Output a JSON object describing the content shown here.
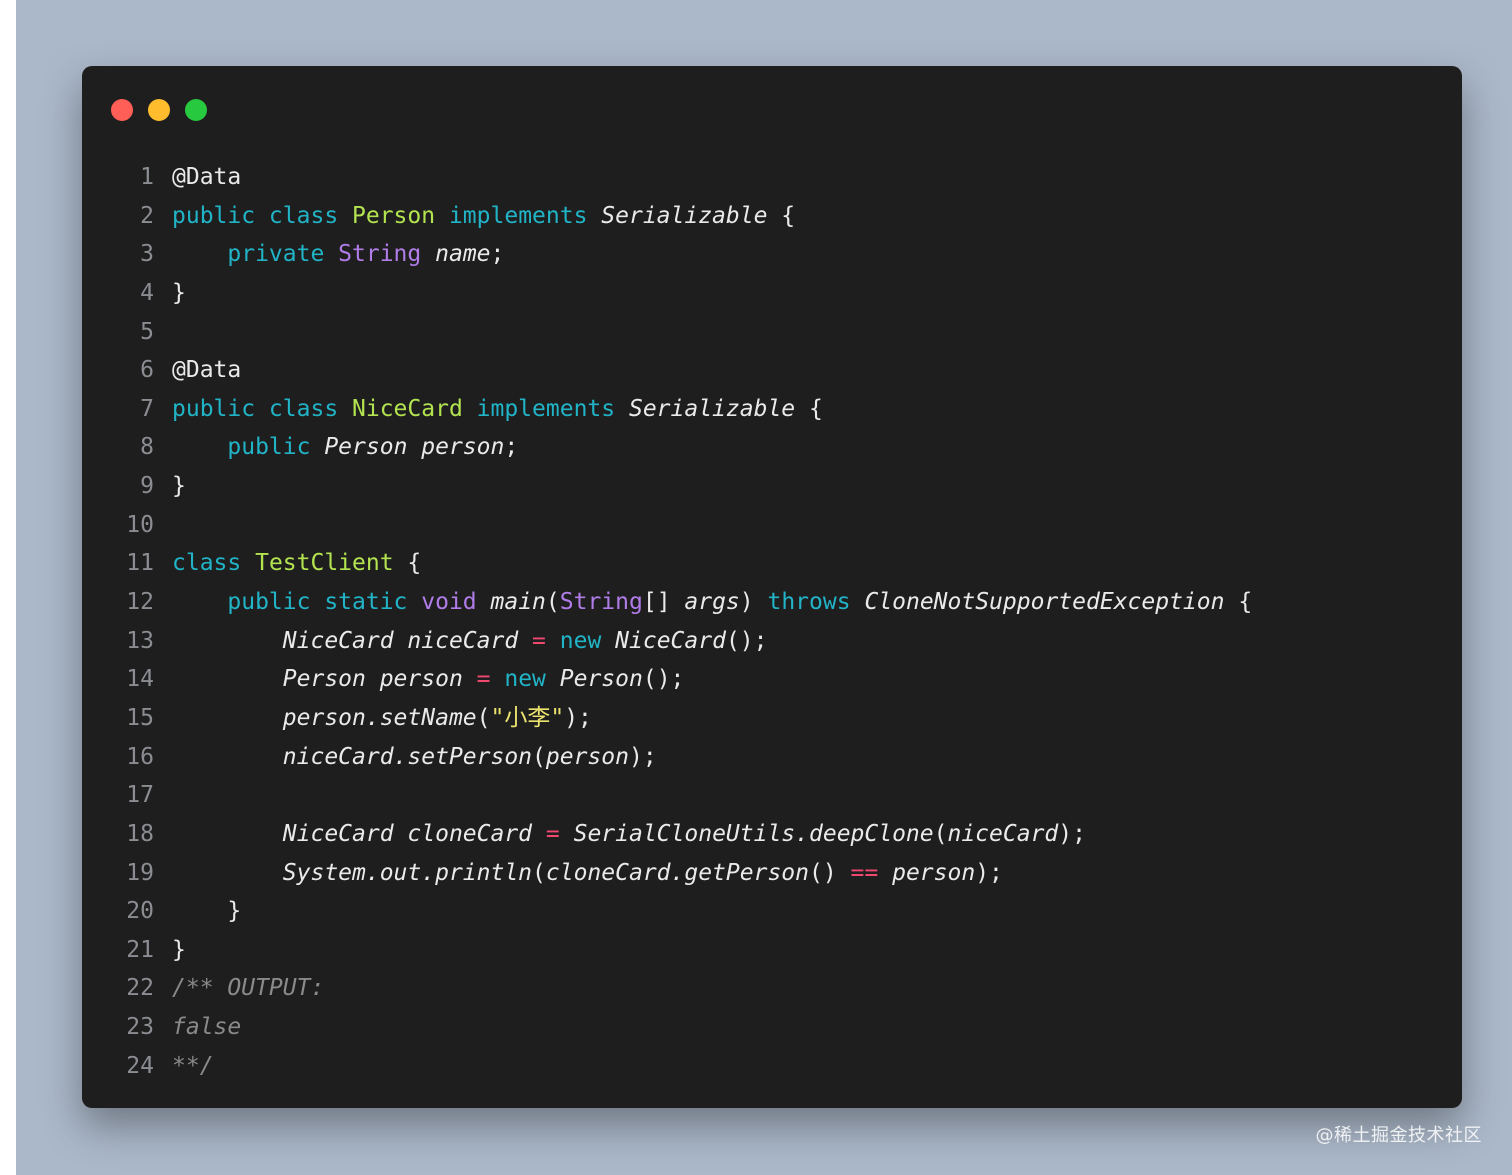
{
  "colors": {
    "background": "#abb8c9",
    "window": "#1e1e1f",
    "dot_close": "#ff5f56",
    "dot_minimize": "#ffbd2e",
    "dot_maximize": "#27c93f",
    "keyword": "#21b3c6",
    "type": "#b07ce8",
    "class_name": "#b3e34f",
    "string": "#ece36f",
    "operator": "#f0486f",
    "comment": "#8a8a8a",
    "plain": "#eaeaea"
  },
  "window": {
    "dots": [
      "close-dot",
      "minimize-dot",
      "maximize-dot"
    ]
  },
  "code": {
    "lines": [
      {
        "n": "1",
        "tokens": [
          {
            "t": "@Data",
            "c": "plain"
          }
        ]
      },
      {
        "n": "2",
        "tokens": [
          {
            "t": "public class ",
            "c": "keyword"
          },
          {
            "t": "Person",
            "c": "class_name"
          },
          {
            "t": " implements ",
            "c": "keyword"
          },
          {
            "t": "Serializable",
            "c": "plain",
            "i": true
          },
          {
            "t": " {",
            "c": "plain"
          }
        ]
      },
      {
        "n": "3",
        "tokens": [
          {
            "t": "    private ",
            "c": "keyword"
          },
          {
            "t": "String",
            "c": "type"
          },
          {
            "t": " ",
            "c": "plain"
          },
          {
            "t": "name",
            "c": "plain",
            "i": true
          },
          {
            "t": ";",
            "c": "plain"
          }
        ]
      },
      {
        "n": "4",
        "tokens": [
          {
            "t": "}",
            "c": "plain"
          }
        ]
      },
      {
        "n": "5",
        "tokens": []
      },
      {
        "n": "6",
        "tokens": [
          {
            "t": "@Data",
            "c": "plain"
          }
        ]
      },
      {
        "n": "7",
        "tokens": [
          {
            "t": "public class ",
            "c": "keyword"
          },
          {
            "t": "NiceCard",
            "c": "class_name"
          },
          {
            "t": " implements ",
            "c": "keyword"
          },
          {
            "t": "Serializable",
            "c": "plain",
            "i": true
          },
          {
            "t": " {",
            "c": "plain"
          }
        ]
      },
      {
        "n": "8",
        "tokens": [
          {
            "t": "    public ",
            "c": "keyword"
          },
          {
            "t": "Person person",
            "c": "plain",
            "i": true
          },
          {
            "t": ";",
            "c": "plain"
          }
        ]
      },
      {
        "n": "9",
        "tokens": [
          {
            "t": "}",
            "c": "plain"
          }
        ]
      },
      {
        "n": "10",
        "tokens": []
      },
      {
        "n": "11",
        "tokens": [
          {
            "t": "class ",
            "c": "keyword"
          },
          {
            "t": "TestClient",
            "c": "class_name"
          },
          {
            "t": " {",
            "c": "plain"
          }
        ]
      },
      {
        "n": "12",
        "tokens": [
          {
            "t": "    public static ",
            "c": "keyword"
          },
          {
            "t": "void",
            "c": "type"
          },
          {
            "t": " ",
            "c": "plain"
          },
          {
            "t": "main",
            "c": "plain",
            "i": true
          },
          {
            "t": "(",
            "c": "plain"
          },
          {
            "t": "String",
            "c": "type"
          },
          {
            "t": "[] ",
            "c": "plain"
          },
          {
            "t": "args",
            "c": "plain",
            "i": true
          },
          {
            "t": ") ",
            "c": "plain"
          },
          {
            "t": "throws",
            "c": "keyword"
          },
          {
            "t": " ",
            "c": "plain"
          },
          {
            "t": "CloneNotSupportedException",
            "c": "plain",
            "i": true
          },
          {
            "t": " {",
            "c": "plain"
          }
        ]
      },
      {
        "n": "13",
        "tokens": [
          {
            "t": "        NiceCard niceCard ",
            "c": "plain",
            "i": true
          },
          {
            "t": "=",
            "c": "operator"
          },
          {
            "t": " ",
            "c": "plain"
          },
          {
            "t": "new",
            "c": "keyword"
          },
          {
            "t": " ",
            "c": "plain"
          },
          {
            "t": "NiceCard",
            "c": "plain",
            "i": true
          },
          {
            "t": "();",
            "c": "plain"
          }
        ]
      },
      {
        "n": "14",
        "tokens": [
          {
            "t": "        Person person ",
            "c": "plain",
            "i": true
          },
          {
            "t": "=",
            "c": "operator"
          },
          {
            "t": " ",
            "c": "plain"
          },
          {
            "t": "new",
            "c": "keyword"
          },
          {
            "t": " ",
            "c": "plain"
          },
          {
            "t": "Person",
            "c": "plain",
            "i": true
          },
          {
            "t": "();",
            "c": "plain"
          }
        ]
      },
      {
        "n": "15",
        "tokens": [
          {
            "t": "        person.setName",
            "c": "plain",
            "i": true
          },
          {
            "t": "(",
            "c": "plain"
          },
          {
            "t": "\"小李\"",
            "c": "string"
          },
          {
            "t": ");",
            "c": "plain"
          }
        ]
      },
      {
        "n": "16",
        "tokens": [
          {
            "t": "        niceCard.setPerson",
            "c": "plain",
            "i": true
          },
          {
            "t": "(",
            "c": "plain"
          },
          {
            "t": "person",
            "c": "plain",
            "i": true
          },
          {
            "t": ");",
            "c": "plain"
          }
        ]
      },
      {
        "n": "17",
        "tokens": []
      },
      {
        "n": "18",
        "tokens": [
          {
            "t": "        NiceCard cloneCard ",
            "c": "plain",
            "i": true
          },
          {
            "t": "=",
            "c": "operator"
          },
          {
            "t": " ",
            "c": "plain"
          },
          {
            "t": "SerialCloneUtils.deepClone",
            "c": "plain",
            "i": true
          },
          {
            "t": "(",
            "c": "plain"
          },
          {
            "t": "niceCard",
            "c": "plain",
            "i": true
          },
          {
            "t": ");",
            "c": "plain"
          }
        ]
      },
      {
        "n": "19",
        "tokens": [
          {
            "t": "        System.out.println",
            "c": "plain",
            "i": true
          },
          {
            "t": "(",
            "c": "plain"
          },
          {
            "t": "cloneCard.getPerson",
            "c": "plain",
            "i": true
          },
          {
            "t": "() ",
            "c": "plain"
          },
          {
            "t": "==",
            "c": "operator"
          },
          {
            "t": " ",
            "c": "plain"
          },
          {
            "t": "person",
            "c": "plain",
            "i": true
          },
          {
            "t": ");",
            "c": "plain"
          }
        ]
      },
      {
        "n": "20",
        "tokens": [
          {
            "t": "    }",
            "c": "plain"
          }
        ]
      },
      {
        "n": "21",
        "tokens": [
          {
            "t": "}",
            "c": "plain"
          }
        ]
      },
      {
        "n": "22",
        "tokens": [
          {
            "t": "/** OUTPUT:",
            "c": "comment",
            "i": true
          }
        ]
      },
      {
        "n": "23",
        "tokens": [
          {
            "t": "false",
            "c": "comment",
            "i": true
          }
        ]
      },
      {
        "n": "24",
        "tokens": [
          {
            "t": "**/",
            "c": "comment",
            "i": true
          }
        ]
      }
    ]
  },
  "watermark": "@稀土掘金技术社区"
}
